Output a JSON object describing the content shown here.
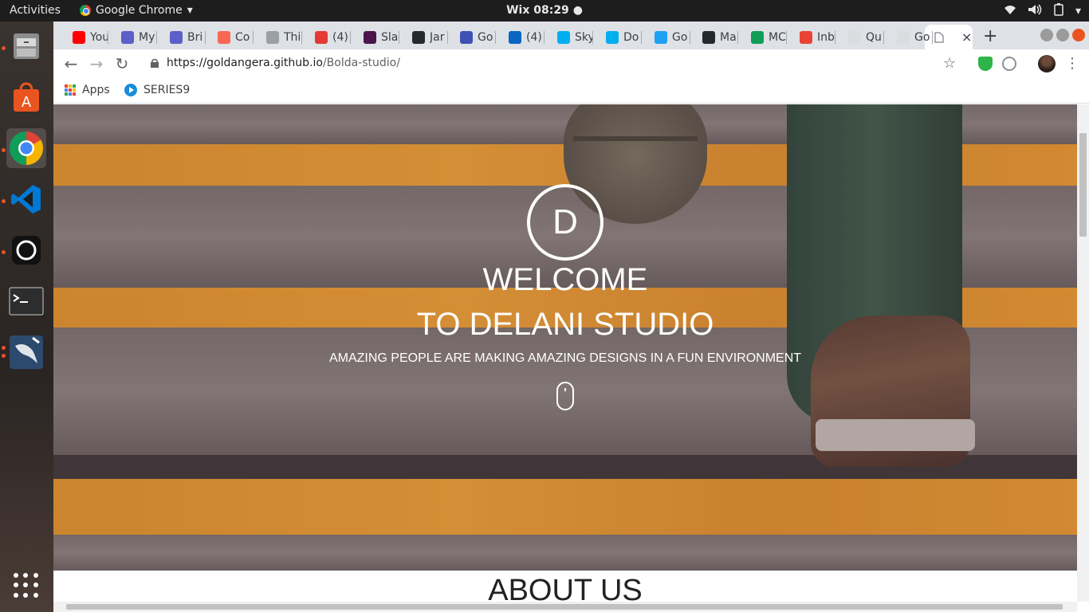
{
  "system": {
    "activities": "Activities",
    "app_name": "Google Chrome",
    "clock": "Wix 08:29"
  },
  "tabs": [
    {
      "title": "You",
      "color": "#ff0000"
    },
    {
      "title": "My",
      "color": "#5b5fc7"
    },
    {
      "title": "Bri",
      "color": "#5b5fc7"
    },
    {
      "title": "Co",
      "color": "#f96854"
    },
    {
      "title": "Thi",
      "color": "#9aa0a6"
    },
    {
      "title": "(4)",
      "color": "#e53935"
    },
    {
      "title": "Sla",
      "color": "#4a154b"
    },
    {
      "title": "Jar",
      "color": "#24292e"
    },
    {
      "title": "Go",
      "color": "#3f51b5"
    },
    {
      "title": "(4)",
      "color": "#0a66c2"
    },
    {
      "title": "Sky",
      "color": "#00aff0"
    },
    {
      "title": "Do",
      "color": "#00aff0"
    },
    {
      "title": "Go",
      "color": "#1da1f2"
    },
    {
      "title": "Ma",
      "color": "#24292e"
    },
    {
      "title": "MC",
      "color": "#0f9d58"
    },
    {
      "title": "Inb",
      "color": "#ea4335"
    },
    {
      "title": "Qu",
      "color": "#dadce0"
    },
    {
      "title": "Go",
      "color": "#dadce0"
    }
  ],
  "active_tab_close": "×",
  "toolbar": {
    "url_host": "https://goldangera.github.io",
    "url_path": "/Bolda-studio/"
  },
  "bookmarks": {
    "apps": "Apps",
    "series": "SERIES9"
  },
  "hero": {
    "logo_letter": "D",
    "welcome": "WELCOME",
    "studio": "TO DELANI STUDIO",
    "tagline": "AMAZING PEOPLE ARE MAKING AMAZING DESIGNS IN A FUN ENVIRONMENT"
  },
  "about": {
    "heading": "ABOUT US"
  }
}
